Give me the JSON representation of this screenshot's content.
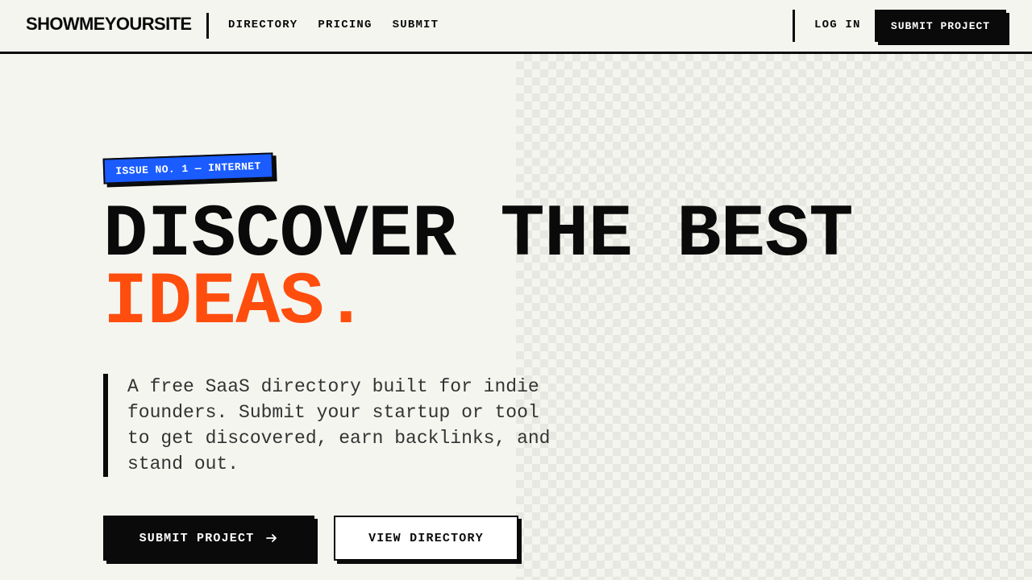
{
  "nav": {
    "brand": "SHOWMEYOURSITE",
    "links": [
      "DIRECTORY",
      "PRICING",
      "SUBMIT"
    ],
    "login": "LOG IN",
    "cta": "SUBMIT PROJECT"
  },
  "hero": {
    "badge": "ISSUE NO. 1 — INTERNET",
    "headline_line1": "DISCOVER THE BEST",
    "headline_line2": "IDEAS.",
    "lead": "A free SaaS directory built for indie founders. Submit your startup or tool to get discovered, earn backlinks, and stand out.",
    "primary_button": "SUBMIT PROJECT",
    "secondary_button": "VIEW DIRECTORY"
  },
  "icons": {
    "primary_button_icon": "arrow-right-icon"
  },
  "colors": {
    "background": "#f5f5f0",
    "ink": "#0a0a0a",
    "accent_orange": "#ff4d0d",
    "badge_blue": "#1a5cff"
  }
}
